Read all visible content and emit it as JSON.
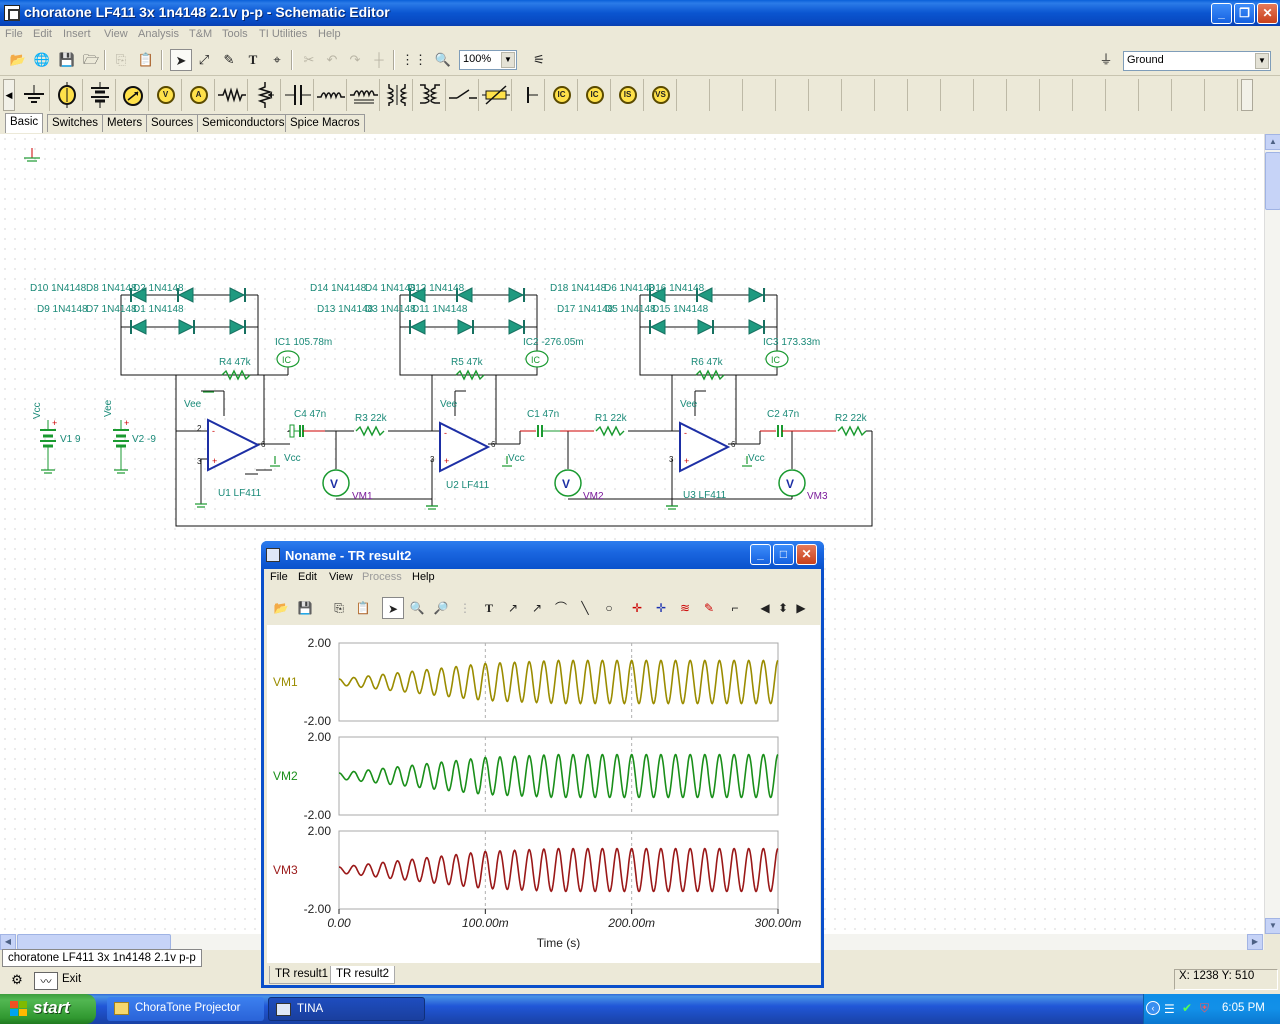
{
  "window": {
    "title": "choratone LF411 3x 1n4148 2.1v p-p - Schematic Editor"
  },
  "menu": [
    "File",
    "Edit",
    "Insert",
    "View",
    "Analysis",
    "T&M",
    "Tools",
    "TI Utilities",
    "Help"
  ],
  "toolbar": {
    "zoom": "100%",
    "ground_select": "Ground"
  },
  "component_tabs": [
    "Basic",
    "Switches",
    "Meters",
    "Sources",
    "Semiconductors",
    "Spice Macros"
  ],
  "palette_icons": [
    "ground-icon",
    "voltage-source-icon",
    "battery-icon",
    "current-source-icon",
    "voltmeter-icon",
    "ammeter-icon",
    "resistor-icon",
    "potentiometer-icon",
    "capacitor-icon",
    "inductor-icon",
    "transformer-icon",
    "coupled-inductor-icon",
    "ideal-transformer-icon",
    "switch-icon",
    "variable-resistor-icon",
    "wire-end-icon",
    "current-meter-icon",
    "current-arrow-icon",
    "vs-icon",
    "vs-arrow-icon"
  ],
  "palette_labels": {
    "ic1": "IC",
    "ic2": "IC",
    "is": "IS",
    "vs": "VS",
    "v": "V",
    "a": "A"
  },
  "schematic": {
    "sources": {
      "v1_name": "V1 9",
      "v2_name": "V2 -9",
      "vcc": "Vcc",
      "vee": "Vee"
    },
    "stage1": {
      "d_top_left": "D10 1N4148",
      "d_top_right": "D8 1N4148",
      "d_top_over": "D2 1N4148",
      "d_bot_left": "D9 1N4148",
      "d_bot_right": "D7 1N4148",
      "d_bot_over": "D1 1N4148",
      "feedback": "R4 47k",
      "ic": "IC1 105.78m",
      "cap": "C4 47n",
      "res": "R3 22k",
      "opamp": "U1 LF411",
      "meter": "VM1",
      "vee": "Vee",
      "vcc": "Vcc"
    },
    "stage2": {
      "d_top_left": "D14 1N4148",
      "d_top_right": "D4 1N4148",
      "d_top_over": "D12 1N4148",
      "d_bot_left": "D13 1N4148",
      "d_bot_right": "D3 1N4148",
      "d_bot_over": "D11 1N4148",
      "feedback": "R5 47k",
      "ic": "IC2 -276.05m",
      "cap": "C1 47n",
      "res": "R1 22k",
      "opamp": "U2 LF411",
      "meter": "VM2",
      "vee": "Vee",
      "vcc": "Vcc"
    },
    "stage3": {
      "d_top_left": "D18 1N4148",
      "d_top_right": "D6 1N4148",
      "d_top_over": "D16 1N4148",
      "d_bot_left": "D17 1N4148",
      "d_bot_right": "D5 1N4148",
      "d_bot_over": "D15 1N4148",
      "feedback": "R6 47k",
      "ic": "IC3 173.33m",
      "cap": "C2 47n",
      "res": "R2 22k",
      "opamp": "U3 LF411",
      "meter": "VM3",
      "vee": "Vee",
      "vcc": "Vcc"
    },
    "pin_labels": {
      "inv": "2",
      "noninv": "3",
      "out": "6",
      "plus": "+",
      "minus": "-"
    },
    "meter_glyph": "V",
    "ic_glyph": "IC"
  },
  "document_tab": "choratone LF411 3x 1n4148 2.1v p-p",
  "bottom_buttons": {
    "exit": "Exit"
  },
  "status": {
    "coords": "X: 1238 Y: 510"
  },
  "result_window": {
    "title": "Noname - TR result2",
    "menu": [
      "File",
      "Edit",
      "View",
      "Process",
      "Help"
    ],
    "tabs": [
      "TR result1",
      "TR result2"
    ],
    "active_tab": "TR result2"
  },
  "chart_data": {
    "type": "line",
    "xlabel": "Time (s)",
    "xlim": [
      0,
      0.3
    ],
    "x_ticks": [
      "0.00",
      "100.00m",
      "200.00m",
      "300.00m"
    ],
    "grid": "dashed vertical at 100.00m and 200.00m",
    "panels": [
      {
        "name": "VM1",
        "ylim": [
          -2.0,
          2.0
        ],
        "y_ticks": [
          "2.00",
          "-2.00"
        ],
        "color": "#9a8c00",
        "envelope": {
          "t": [
            0,
            0.05,
            0.1,
            0.15,
            0.2,
            0.3
          ],
          "amp": [
            0.15,
            0.55,
            0.95,
            1.1,
            1.1,
            1.1
          ]
        },
        "cycles": 30
      },
      {
        "name": "VM2",
        "ylim": [
          -2.0,
          2.0
        ],
        "y_ticks": [
          "2.00",
          "-2.00"
        ],
        "color": "#1a8f1a",
        "envelope": {
          "t": [
            0,
            0.05,
            0.1,
            0.15,
            0.2,
            0.3
          ],
          "amp": [
            0.15,
            0.55,
            0.95,
            1.1,
            1.1,
            1.1
          ]
        },
        "cycles": 30
      },
      {
        "name": "VM3",
        "ylim": [
          -2.0,
          2.0
        ],
        "y_ticks": [
          "2.00",
          "-2.00"
        ],
        "color": "#9a1818",
        "envelope": {
          "t": [
            0,
            0.05,
            0.1,
            0.15,
            0.2,
            0.3
          ],
          "amp": [
            0.15,
            0.55,
            0.95,
            1.1,
            1.1,
            1.1
          ]
        },
        "cycles": 30
      }
    ]
  },
  "taskbar": {
    "start": "start",
    "buttons": [
      "ChoraTone Projector",
      "TINA"
    ],
    "clock": "6:05 PM"
  }
}
